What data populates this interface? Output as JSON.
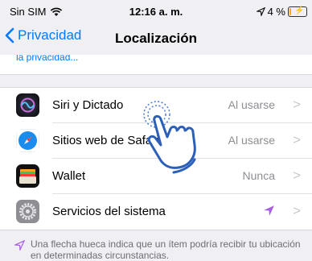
{
  "status": {
    "carrier": "Sin SIM",
    "time": "12:16 a. m.",
    "battery_percent": "4 %",
    "battery_level": 0.04
  },
  "nav": {
    "back_label": "Privacidad",
    "title": "Localización"
  },
  "peek_text": "la privacidad...",
  "rows": [
    {
      "label": "Siri y Dictado",
      "value": "Al usarse",
      "icon": "siri-icon"
    },
    {
      "label": "Sitios web de Safari",
      "value": "Al usarse",
      "icon": "safari-icon"
    },
    {
      "label": "Wallet",
      "value": "Nunca",
      "icon": "wallet-icon"
    },
    {
      "label": "Servicios del sistema",
      "value": "",
      "icon": "settings-gear-icon",
      "accessory": "location-arrow-icon"
    }
  ],
  "footer_text": "Una flecha hueca indica que un ítem podría recibir tu ubicación en determinadas circunstancias.",
  "colors": {
    "accent": "#007aff",
    "location_purple": "#a65fe2",
    "secondary_text": "#8e8e93"
  }
}
